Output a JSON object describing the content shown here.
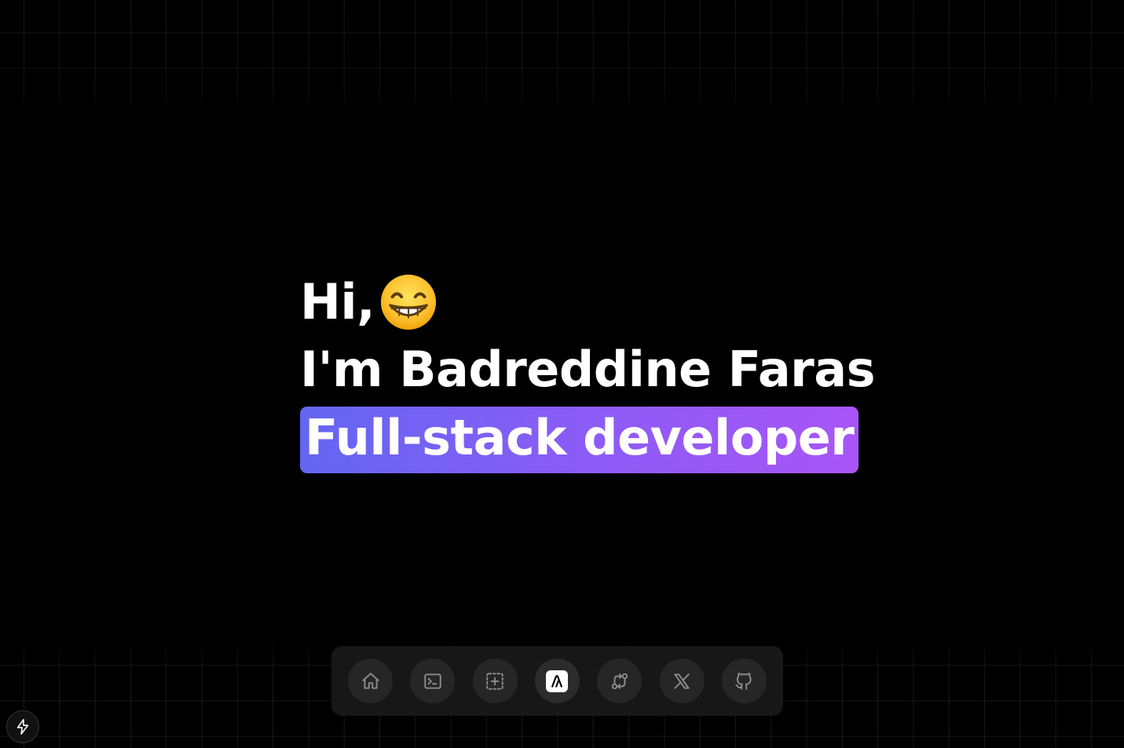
{
  "hero": {
    "greeting": "Hi,",
    "greeting_emoji": "grinning-face-emoji",
    "intro": "I'm Badreddine Faras",
    "role": "Full-stack developer",
    "role_gradient": [
      "#6366f1",
      "#a855f7"
    ]
  },
  "dock": {
    "items": [
      {
        "icon": "home-icon",
        "active": false
      },
      {
        "icon": "terminal-icon",
        "active": false
      },
      {
        "icon": "focus-icon",
        "active": false
      },
      {
        "icon": "brand-logo-icon",
        "active": true
      },
      {
        "icon": "git-compare-icon",
        "active": false
      },
      {
        "icon": "x-twitter-icon",
        "active": false
      },
      {
        "icon": "github-icon",
        "active": false
      }
    ]
  },
  "corner_badge": {
    "icon": "bolt-icon"
  },
  "colors": {
    "background": "#000000",
    "dock_bg": "#171717",
    "dock_button_bg": "#262626",
    "icon_color": "#8a8a8a"
  }
}
